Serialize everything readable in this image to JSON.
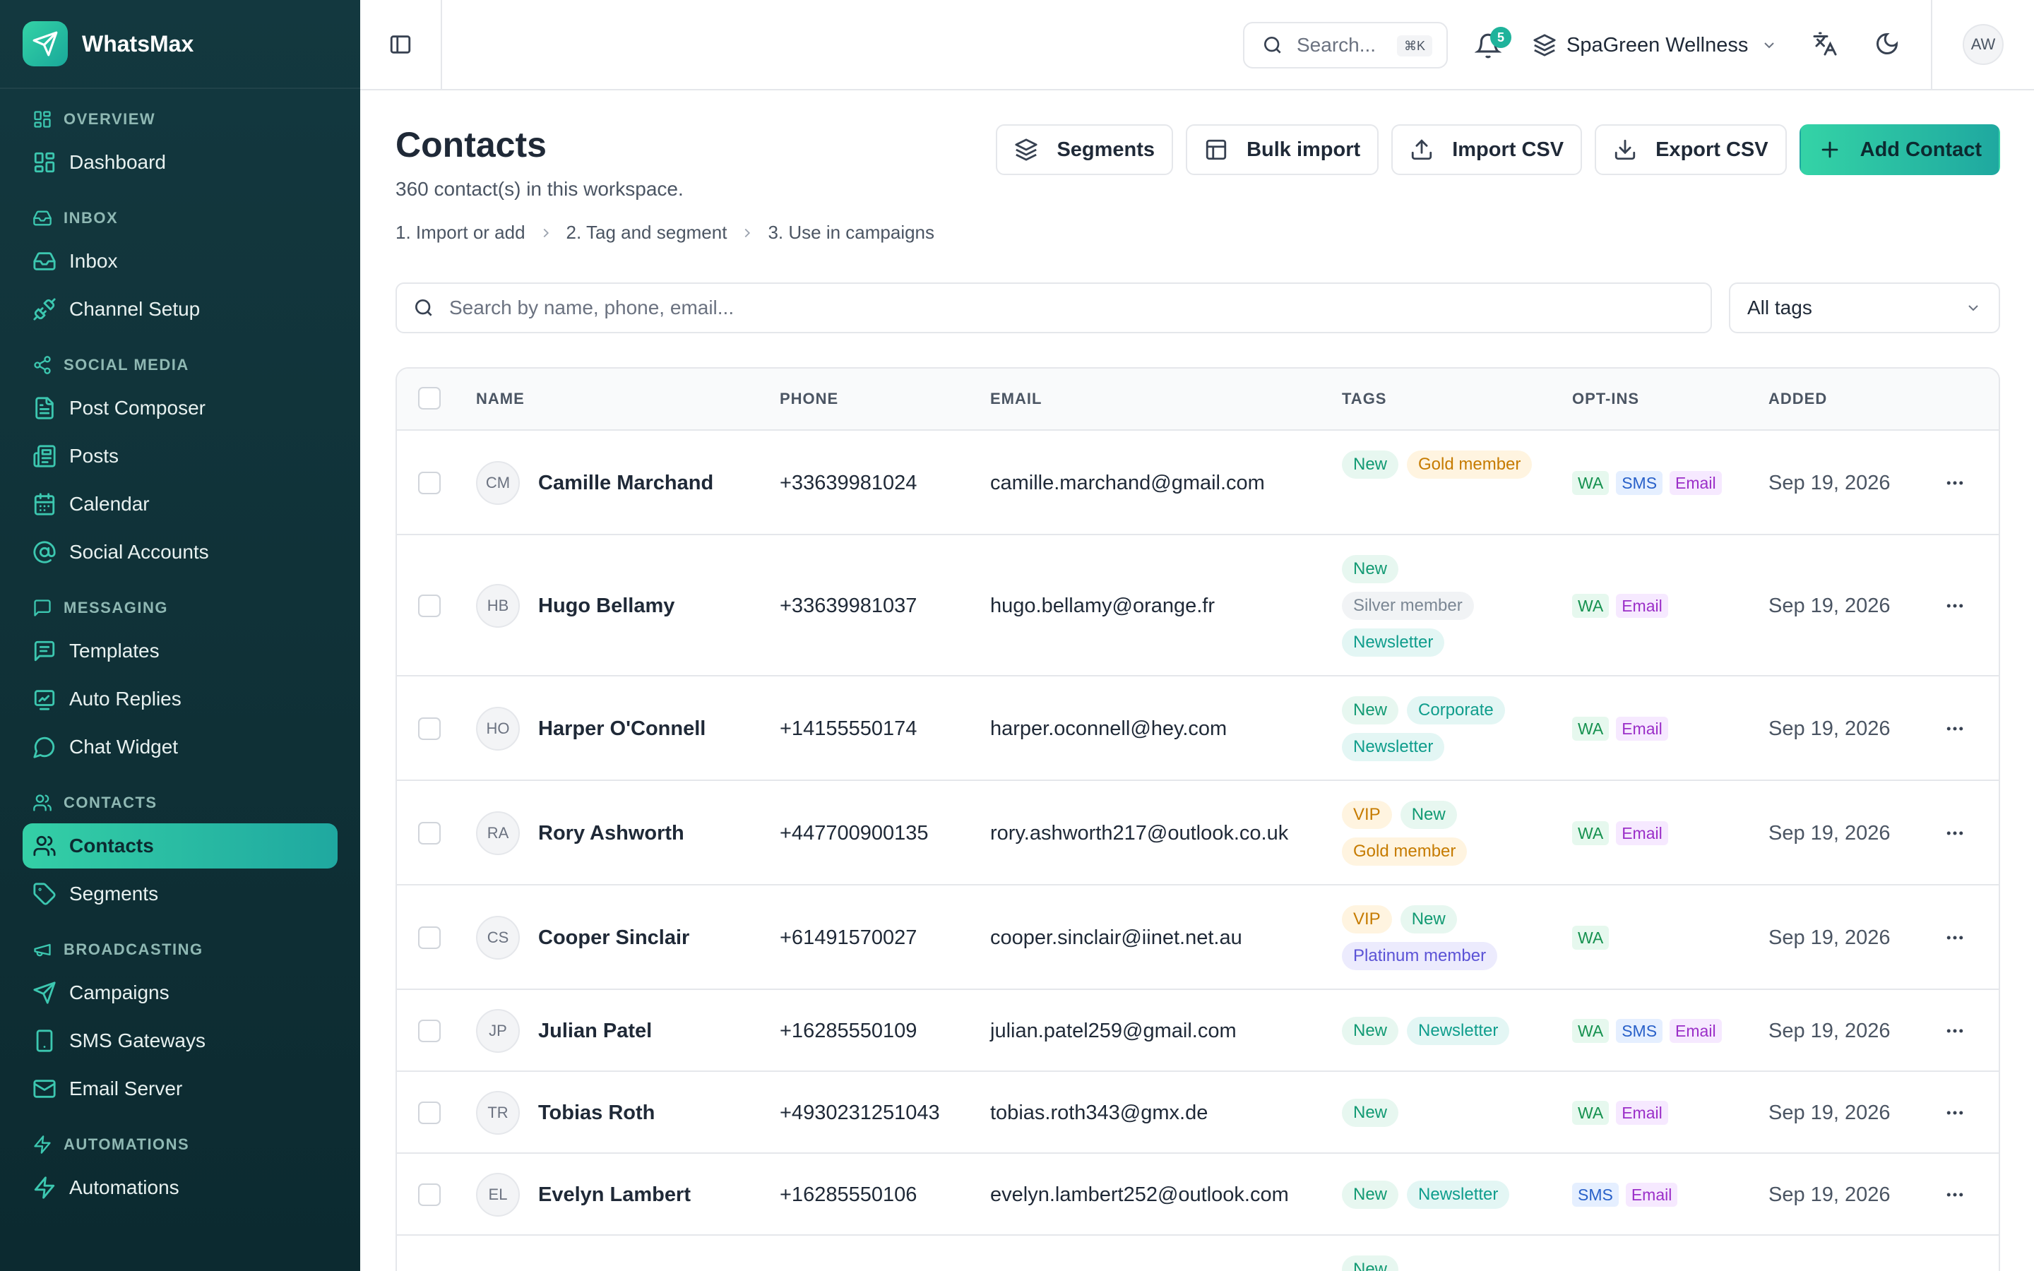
{
  "app": {
    "name": "WhatsMax"
  },
  "sidebar": {
    "sections": [
      {
        "title": "OVERVIEW",
        "icon": "grid-icon",
        "items": [
          {
            "label": "Dashboard",
            "icon": "grid-icon"
          }
        ]
      },
      {
        "title": "INBOX",
        "icon": "inbox-icon",
        "items": [
          {
            "label": "Inbox",
            "icon": "inbox-icon"
          },
          {
            "label": "Channel Setup",
            "icon": "plug-icon"
          }
        ]
      },
      {
        "title": "SOCIAL MEDIA",
        "icon": "share-icon",
        "items": [
          {
            "label": "Post Composer",
            "icon": "document-icon"
          },
          {
            "label": "Posts",
            "icon": "newspaper-icon"
          },
          {
            "label": "Calendar",
            "icon": "calendar-icon"
          },
          {
            "label": "Social Accounts",
            "icon": "at-sign-icon"
          }
        ]
      },
      {
        "title": "MESSAGING",
        "icon": "message-square-icon",
        "items": [
          {
            "label": "Templates",
            "icon": "template-icon"
          },
          {
            "label": "Auto Replies",
            "icon": "auto-reply-icon"
          },
          {
            "label": "Chat Widget",
            "icon": "chat-bubble-icon"
          }
        ]
      },
      {
        "title": "CONTACTS",
        "icon": "users-icon",
        "items": [
          {
            "label": "Contacts",
            "icon": "users-icon",
            "active": true
          },
          {
            "label": "Segments",
            "icon": "tag-icon"
          }
        ]
      },
      {
        "title": "BROADCASTING",
        "icon": "megaphone-icon",
        "items": [
          {
            "label": "Campaigns",
            "icon": "send-icon"
          },
          {
            "label": "SMS Gateways",
            "icon": "smartphone-icon"
          },
          {
            "label": "Email Server",
            "icon": "mail-icon"
          }
        ]
      },
      {
        "title": "AUTOMATIONS",
        "icon": "zap-icon",
        "items": [
          {
            "label": "Automations",
            "icon": "zap-icon"
          }
        ]
      }
    ]
  },
  "topbar": {
    "search_placeholder": "Search...",
    "search_shortcut": "⌘K",
    "notification_count": "5",
    "workspace": "SpaGreen Wellness",
    "avatar_initials": "AW"
  },
  "page": {
    "title": "Contacts",
    "subtitle": "360 contact(s) in this workspace.",
    "steps": [
      "1. Import or add",
      "2. Tag and segment",
      "3. Use in campaigns"
    ],
    "actions": {
      "segments": "Segments",
      "bulk_import": "Bulk import",
      "import_csv": "Import CSV",
      "export_csv": "Export CSV",
      "add_contact": "Add Contact"
    },
    "search_placeholder": "Search by name, phone, email...",
    "tag_filter": "All tags"
  },
  "table": {
    "columns": {
      "name": "NAME",
      "phone": "PHONE",
      "email": "EMAIL",
      "tags": "TAGS",
      "optins": "OPT-INS",
      "added": "ADDED"
    },
    "rows": [
      {
        "initials": "CM",
        "name": "Camille Marchand",
        "phone": "+33639981024",
        "email": "camille.marchand@gmail.com",
        "tags": [
          {
            "label": "New",
            "color": "green"
          },
          {
            "label": "Gold member",
            "color": "gold"
          }
        ],
        "optins": [
          "WA",
          "SMS",
          "Email"
        ],
        "added": "Sep 19, 2026"
      },
      {
        "initials": "HB",
        "name": "Hugo Bellamy",
        "phone": "+33639981037",
        "email": "hugo.bellamy@orange.fr",
        "tags": [
          {
            "label": "New",
            "color": "green"
          },
          {
            "label": "Silver member",
            "color": "silver"
          },
          {
            "label": "Newsletter",
            "color": "teal"
          }
        ],
        "optins": [
          "WA",
          "Email"
        ],
        "added": "Sep 19, 2026"
      },
      {
        "initials": "HO",
        "name": "Harper O'Connell",
        "phone": "+14155550174",
        "email": "harper.oconnell@hey.com",
        "tags": [
          {
            "label": "New",
            "color": "green"
          },
          {
            "label": "Corporate",
            "color": "teal"
          },
          {
            "label": "Newsletter",
            "color": "teal"
          }
        ],
        "optins": [
          "WA",
          "Email"
        ],
        "added": "Sep 19, 2026"
      },
      {
        "initials": "RA",
        "name": "Rory Ashworth",
        "phone": "+447700900135",
        "email": "rory.ashworth217@outlook.co.uk",
        "tags": [
          {
            "label": "VIP",
            "color": "gold"
          },
          {
            "label": "New",
            "color": "green"
          },
          {
            "label": "Gold member",
            "color": "gold"
          }
        ],
        "optins": [
          "WA",
          "Email"
        ],
        "added": "Sep 19, 2026"
      },
      {
        "initials": "CS",
        "name": "Cooper Sinclair",
        "phone": "+61491570027",
        "email": "cooper.sinclair@iinet.net.au",
        "tags": [
          {
            "label": "VIP",
            "color": "gold"
          },
          {
            "label": "New",
            "color": "green"
          },
          {
            "label": "Platinum member",
            "color": "purple"
          }
        ],
        "optins": [
          "WA"
        ],
        "added": "Sep 19, 2026"
      },
      {
        "initials": "JP",
        "name": "Julian Patel",
        "phone": "+16285550109",
        "email": "julian.patel259@gmail.com",
        "tags": [
          {
            "label": "New",
            "color": "green"
          },
          {
            "label": "Newsletter",
            "color": "teal"
          }
        ],
        "optins": [
          "WA",
          "SMS",
          "Email"
        ],
        "added": "Sep 19, 2026"
      },
      {
        "initials": "TR",
        "name": "Tobias Roth",
        "phone": "+4930231251043",
        "email": "tobias.roth343@gmx.de",
        "tags": [
          {
            "label": "New",
            "color": "green"
          }
        ],
        "optins": [
          "WA",
          "Email"
        ],
        "added": "Sep 19, 2026"
      },
      {
        "initials": "EL",
        "name": "Evelyn Lambert",
        "phone": "+16285550106",
        "email": "evelyn.lambert252@outlook.com",
        "tags": [
          {
            "label": "New",
            "color": "green"
          },
          {
            "label": "Newsletter",
            "color": "teal"
          }
        ],
        "optins": [
          "SMS",
          "Email"
        ],
        "added": "Sep 19, 2026"
      }
    ],
    "partial_row": {
      "tags": [
        {
          "label": "New",
          "color": "green"
        }
      ]
    }
  }
}
